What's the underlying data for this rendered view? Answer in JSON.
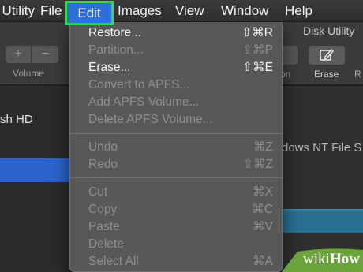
{
  "menubar": {
    "app": "Utility",
    "file": "File",
    "edit": "Edit",
    "images": "Images",
    "view": "View",
    "window": "Window",
    "help": "Help",
    "highlight_color": "#38d64a",
    "selected_color": "#2d6fd9"
  },
  "window": {
    "title": "Disk Utility",
    "volume_add_glyph": "+",
    "volume_remove_glyph": "−",
    "volume_label": "Volume",
    "partition_label_tail": "tion",
    "erase_label": "Erase",
    "restore_label_head": "R",
    "erase_icon": "eraser-pencil-icon",
    "sidebar_item": "sh HD",
    "filesystem_text": "dows NT File S"
  },
  "edit_menu": {
    "items": [
      {
        "label": "Restore...",
        "shortcut": "⇧⌘R",
        "enabled": true
      },
      {
        "label": "Partition...",
        "shortcut": "⇧⌘P",
        "enabled": false
      },
      {
        "label": "Erase...",
        "shortcut": "⇧⌘E",
        "enabled": true
      },
      {
        "label": "Convert to APFS...",
        "shortcut": "",
        "enabled": false
      },
      {
        "label": "Add APFS Volume...",
        "shortcut": "",
        "enabled": false
      },
      {
        "label": "Delete APFS Volume...",
        "shortcut": "",
        "enabled": false
      },
      {
        "label": "Undo",
        "shortcut": "⌘Z",
        "enabled": false
      },
      {
        "label": "Redo",
        "shortcut": "⇧⌘Z",
        "enabled": false
      },
      {
        "label": "Cut",
        "shortcut": "⌘X",
        "enabled": false
      },
      {
        "label": "Copy",
        "shortcut": "⌘C",
        "enabled": false
      },
      {
        "label": "Paste",
        "shortcut": "⌘V",
        "enabled": false
      },
      {
        "label": "Delete",
        "shortcut": "",
        "enabled": false
      },
      {
        "label": "Select All",
        "shortcut": "⌘A",
        "enabled": false
      }
    ]
  },
  "watermark": {
    "wiki": "wiki",
    "how": "How",
    "color": "#6aa33c"
  }
}
